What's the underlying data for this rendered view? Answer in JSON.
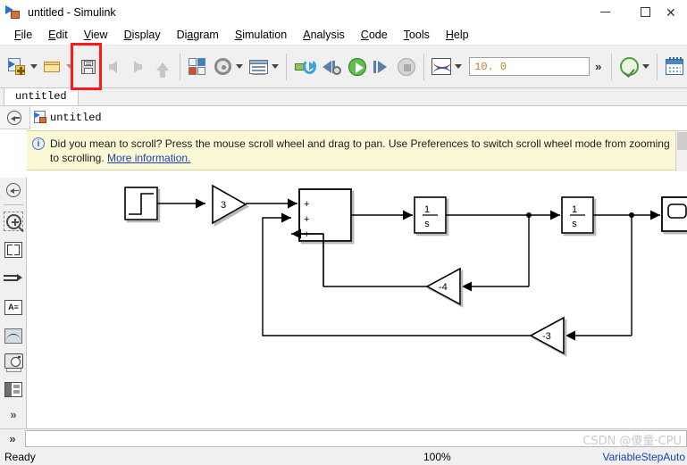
{
  "window": {
    "title": "untitled - Simulink",
    "icon": "simulink-model-icon",
    "controls": {
      "minimize": "—",
      "maximize": "□",
      "close": "✕"
    }
  },
  "menubar": {
    "items": [
      {
        "name": "file",
        "label": "File",
        "accel": "F"
      },
      {
        "name": "edit",
        "label": "Edit",
        "accel": "E"
      },
      {
        "name": "view",
        "label": "View",
        "accel": "V"
      },
      {
        "name": "display",
        "label": "Display",
        "accel": "D"
      },
      {
        "name": "diagram",
        "label": "Diagram",
        "accel": "a"
      },
      {
        "name": "simulation",
        "label": "Simulation",
        "accel": "S"
      },
      {
        "name": "analysis",
        "label": "Analysis",
        "accel": "A"
      },
      {
        "name": "code",
        "label": "Code",
        "accel": "C"
      },
      {
        "name": "tools",
        "label": "Tools",
        "accel": "T"
      },
      {
        "name": "help",
        "label": "Help",
        "accel": "H"
      }
    ]
  },
  "toolbar": {
    "new_model": "new-model-icon",
    "open": "open-folder-icon",
    "save": "save-icon",
    "back": "back-arrow-icon",
    "forward": "forward-arrow-icon",
    "up": "up-arrow-icon",
    "library_browser": "library-browser-icon",
    "model_explorer": "model-explorer-icon",
    "model_configuration": "gear-icon",
    "model_properties": "table-icon",
    "update_model": "update-diagram-icon",
    "step_back": "step-back-icon",
    "run": "run-icon",
    "step_forward": "step-forward-icon",
    "stop": "stop-icon",
    "scope_viewer": "scope-icon",
    "sim_time_value": "10. 0",
    "overflow": "»",
    "model_advisor": "check-circle-icon",
    "scheduler": "calendar-icon",
    "highlight_note": "save-button-highlighted"
  },
  "tabs": [
    {
      "name": "untitled",
      "label": "untitled",
      "active": true
    }
  ],
  "breadcrumb": {
    "back_icon": "back-circle-icon",
    "model_icon": "simulink-model-icon",
    "path": "untitled"
  },
  "notification": {
    "icon": "info-icon",
    "text": "Did you mean to scroll? Press the mouse scroll wheel and drag to pan. Use Preferences to switch scroll wheel mode from zooming to scrolling. ",
    "link": "More information."
  },
  "sidebar": {
    "items": [
      {
        "name": "navigate-back",
        "icon": "back-circle-icon"
      },
      {
        "name": "zoom-in",
        "icon": "zoom-in-icon"
      },
      {
        "name": "fit-to-view",
        "icon": "fit-to-view-icon"
      },
      {
        "name": "signal-routing",
        "icon": "signal-arrow-icon"
      },
      {
        "name": "annotation",
        "icon": "annotation-icon",
        "glyph": "A≡"
      },
      {
        "name": "plot-viewer",
        "icon": "plot-icon"
      },
      {
        "name": "blank-area",
        "icon": "blank-square-icon"
      },
      {
        "name": "snapshot",
        "icon": "camera-icon"
      },
      {
        "name": "panel-layout",
        "icon": "panel-layout-icon"
      },
      {
        "name": "more-tools",
        "icon": "chevron-double-right-icon",
        "glyph": "»"
      }
    ]
  },
  "diagram": {
    "blocks": [
      {
        "name": "step-block",
        "type": "step",
        "label": ""
      },
      {
        "name": "gain-block-3",
        "type": "gain",
        "label": "3"
      },
      {
        "name": "sum-block",
        "type": "sum",
        "signs": [
          "+",
          "+",
          "+"
        ]
      },
      {
        "name": "integrator-1",
        "type": "integrator",
        "numerator": "1",
        "denominator": "s"
      },
      {
        "name": "integrator-2",
        "type": "integrator",
        "numerator": "1",
        "denominator": "s"
      },
      {
        "name": "feedback-gain-4",
        "type": "gain",
        "label": "-4"
      },
      {
        "name": "feedback-gain-3",
        "type": "gain",
        "label": "-3"
      },
      {
        "name": "scope-block",
        "type": "scope",
        "label": ""
      }
    ]
  },
  "statusbar": {
    "command_chevron": "»",
    "command_value": "",
    "ready": "Ready",
    "zoom": "100%",
    "solver": "VariableStepAuto"
  },
  "watermark": {
    "text": "CSDN @傻童·CPU"
  }
}
